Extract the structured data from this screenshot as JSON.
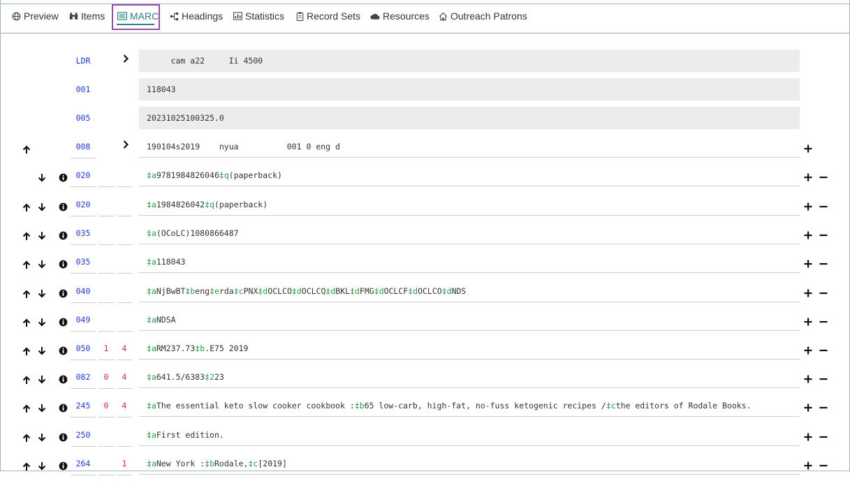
{
  "tabs": [
    {
      "label": "Preview",
      "icon": "globe-icon"
    },
    {
      "label": "Items",
      "icon": "binoculars-icon"
    },
    {
      "label": "MARC",
      "icon": "marc-record-icon"
    },
    {
      "label": "Headings",
      "icon": "hierarchy-icon"
    },
    {
      "label": "Statistics",
      "icon": "bar-chart-icon"
    },
    {
      "label": "Record Sets",
      "icon": "clipboard-icon"
    },
    {
      "label": "Resources",
      "icon": "cloud-icon"
    },
    {
      "label": "Outreach Patrons",
      "icon": "home-icon"
    }
  ],
  "active_tab": "MARC",
  "colors": {
    "tag": "#1f3ccf",
    "indicator": "#d0312d",
    "subfield": "#2e9a4a",
    "active": "#2b7f86",
    "highlight": "#9b4aa9"
  },
  "fields": [
    {
      "tag": "LDR",
      "ind1": "",
      "ind2": "",
      "data": "     cam a22     Ii 4500"
    },
    {
      "tag": "001",
      "ind1": "",
      "ind2": "",
      "data": "118043"
    },
    {
      "tag": "005",
      "ind1": "",
      "ind2": "",
      "data": "20231025100325.0"
    },
    {
      "tag": "008",
      "ind1": "",
      "ind2": "",
      "data": "190104s2019    nyua          001 0 eng d"
    },
    {
      "tag": "020",
      "ind1": "",
      "ind2": "",
      "data": "‡a9781984826046‡q(paperback)"
    },
    {
      "tag": "020",
      "ind1": "",
      "ind2": "",
      "data": "‡a1984826042‡q(paperback)"
    },
    {
      "tag": "035",
      "ind1": "",
      "ind2": "",
      "data": "‡a(OCoLC)1080866487"
    },
    {
      "tag": "035",
      "ind1": "",
      "ind2": "",
      "data": "‡a118043"
    },
    {
      "tag": "040",
      "ind1": "",
      "ind2": "",
      "data": "‡aNjBwBT‡beng‡erda‡cPNX‡dOCLCO‡dOCLCQ‡dBKL‡dFMG‡dOCLCF‡dOCLCO‡dNDS"
    },
    {
      "tag": "049",
      "ind1": "",
      "ind2": "",
      "data": "‡aNDSA"
    },
    {
      "tag": "050",
      "ind1": "1",
      "ind2": "4",
      "data": "‡aRM237.73‡b.E75 2019"
    },
    {
      "tag": "082",
      "ind1": "0",
      "ind2": "4",
      "data": "‡a641.5/6383‡223"
    },
    {
      "tag": "245",
      "ind1": "0",
      "ind2": "4",
      "data": "‡aThe essential keto slow cooker cookbook :‡b65 low-carb, high-fat, no-fuss ketogenic recipes /‡cthe editors of Rodale Books."
    },
    {
      "tag": "250",
      "ind1": "",
      "ind2": "",
      "data": "‡aFirst edition."
    },
    {
      "tag": "264",
      "ind1": "",
      "ind2": "1",
      "data": "‡aNew York :‡bRodale,‡c[2019]"
    }
  ]
}
